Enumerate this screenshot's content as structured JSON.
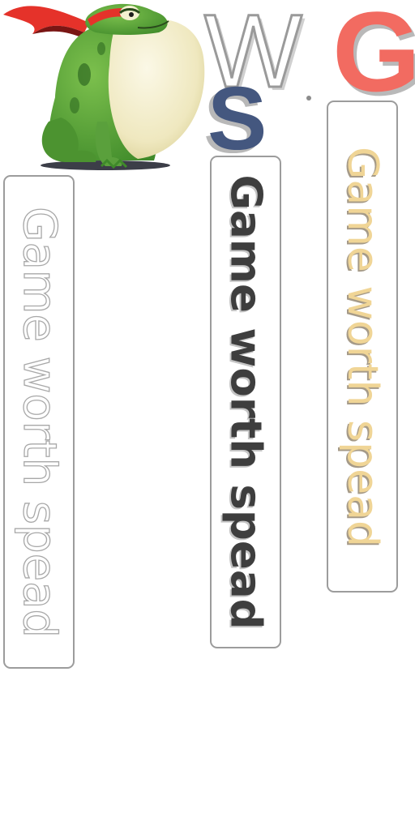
{
  "logo": {
    "letters": [
      "W",
      "G",
      "S"
    ],
    "colors": {
      "w_outline": "#9a9a9a",
      "g_fill": "#f26b61",
      "s_fill": "#44577f"
    }
  },
  "mascot": {
    "icon": "frog-mascot-icon",
    "colors": {
      "body": "#5aa03c",
      "belly": "#f1ecc3",
      "headband": "#e5322a"
    }
  },
  "cards": [
    {
      "text": "Game worth spead",
      "style": "outline-gray"
    },
    {
      "text": "Game worth spead",
      "style": "bold-dark"
    },
    {
      "text": "Game worth spead",
      "style": "gold"
    }
  ]
}
